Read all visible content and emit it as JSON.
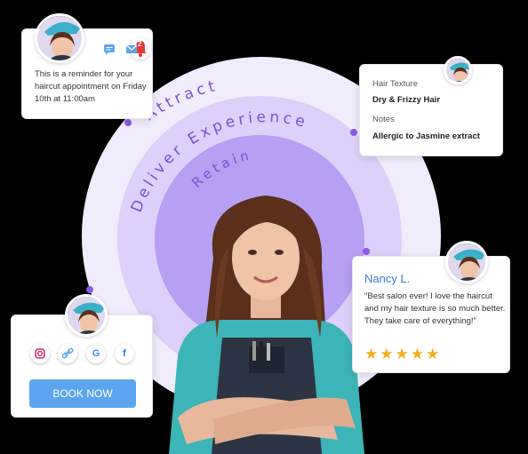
{
  "circle_labels": [
    "Attract",
    "Deliver Experience",
    "Retain"
  ],
  "reminder": {
    "badge_count": "2",
    "message": "This is a reminder for your haircut appointment on Friday 10th at 11:00am"
  },
  "profile": {
    "hair_texture_label": "Hair Texture",
    "hair_texture_value": "Dry & Frizzy Hair",
    "notes_label": "Notes",
    "notes_value": "Allergic to Jasmine extract"
  },
  "review": {
    "name": "Nancy L.",
    "quote": "\"Best salon ever! I love the haircut and my hair texture is so much better. They take care of everything!\"",
    "stars": "★★★★★",
    "rating": 5
  },
  "booking": {
    "socials": [
      "instagram-icon",
      "link-icon",
      "google-icon",
      "facebook-icon"
    ],
    "google_glyph": "G",
    "facebook_glyph": "f",
    "button_label": "BOOK NOW"
  },
  "colors": {
    "accent_purple": "#8a5ce6",
    "button_blue": "#5aa5ee",
    "star_gold": "#f2b01e",
    "name_blue": "#3b7ad9"
  }
}
